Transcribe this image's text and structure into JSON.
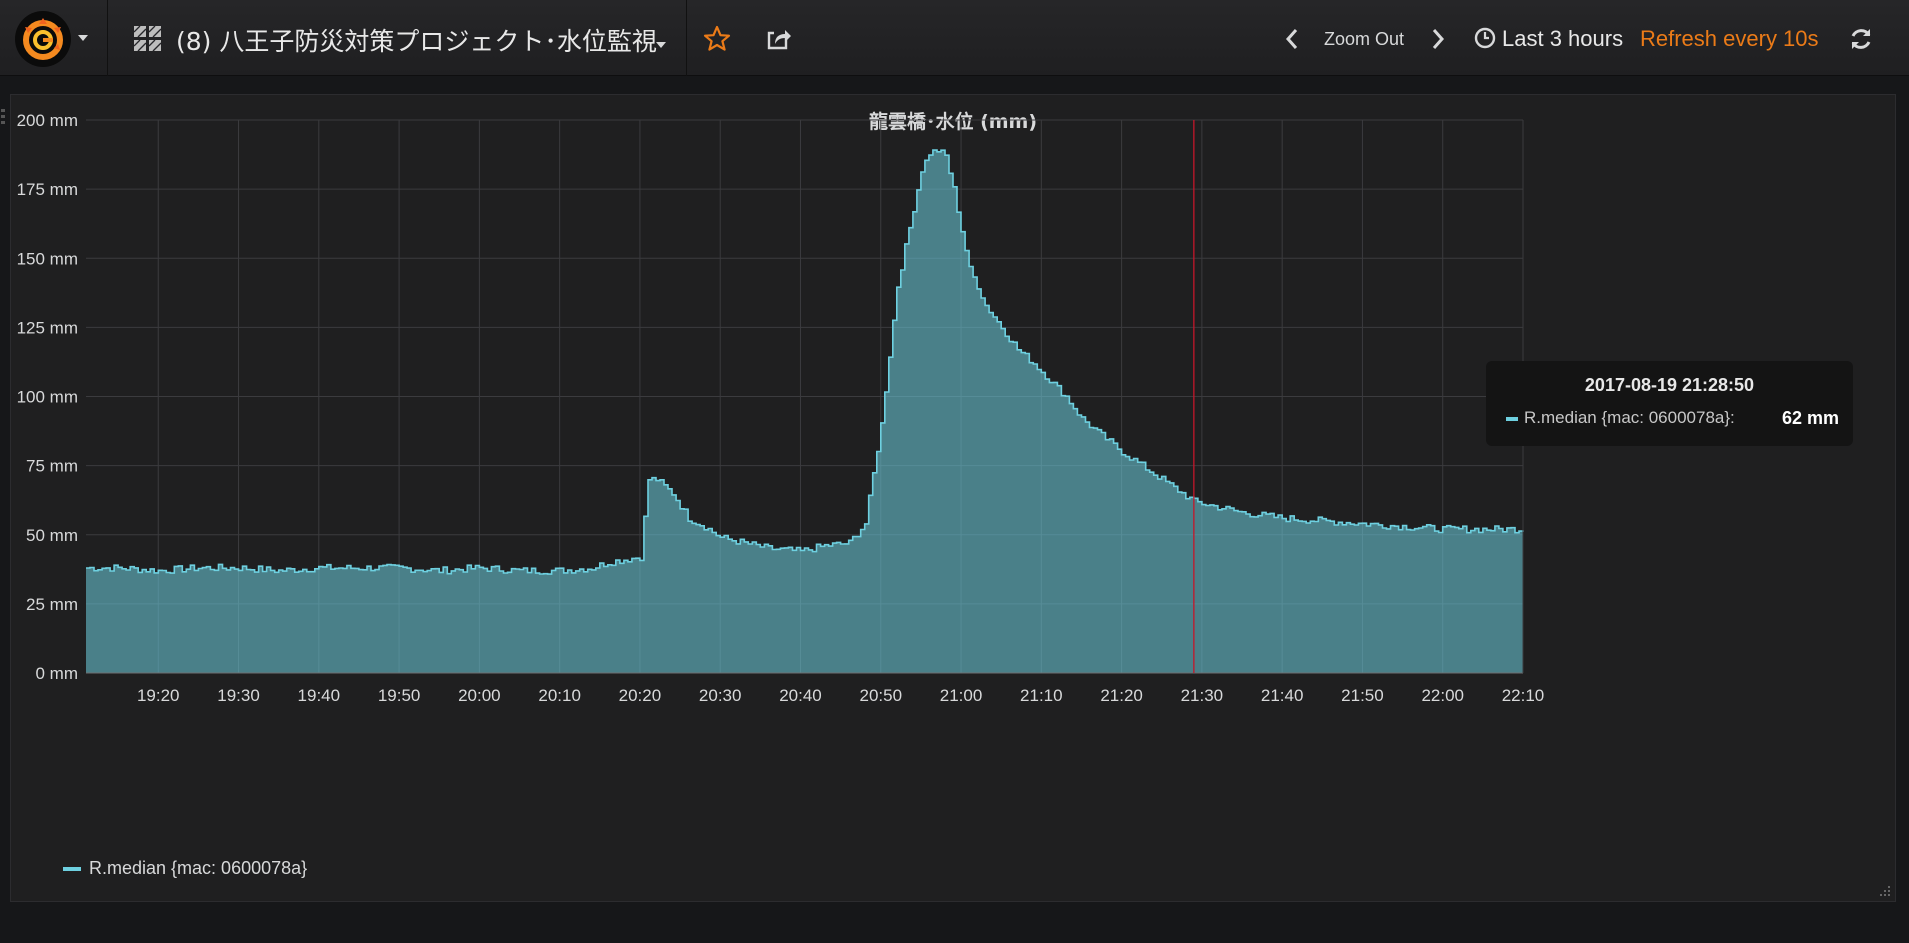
{
  "navbar": {
    "dashboard_title": "(8) 八王子防災対策プロジェクト･水位監視",
    "zoom_out_label": "Zoom Out",
    "time_range_label": "Last 3 hours",
    "refresh_label": "Refresh every 10s"
  },
  "icons": [
    "grafana-logo",
    "dashboard-grid-icon",
    "star-icon",
    "share-icon",
    "chevron-left-icon",
    "chevron-right-icon",
    "clock-icon",
    "refresh-icon"
  ],
  "colors": {
    "series": "#6ed0e0",
    "refresh_accent": "#eb7b18",
    "star": "#eb7b18",
    "cursor_line": "#c4162a"
  },
  "panel": {
    "title": "龍雲橋･水位 (mm)"
  },
  "tooltip": {
    "time": "2017-08-19 21:28:50",
    "series": "R.median {mac: 0600078a}:",
    "value": "62 mm"
  },
  "legend": {
    "label": "R.median {mac: 0600078a}"
  },
  "chart_data": {
    "type": "area",
    "title": "龍雲橋･水位 (mm)",
    "xlabel": "",
    "ylabel": "",
    "ylim": [
      0,
      200
    ],
    "x_range": [
      "19:11",
      "22:10"
    ],
    "y_ticks": [
      "0 mm",
      "25 mm",
      "50 mm",
      "75 mm",
      "100 mm",
      "125 mm",
      "150 mm",
      "175 mm",
      "200 mm"
    ],
    "y_tick_values": [
      0,
      25,
      50,
      75,
      100,
      125,
      150,
      175,
      200
    ],
    "x_ticks": [
      "19:20",
      "19:30",
      "19:40",
      "19:50",
      "20:00",
      "20:10",
      "20:20",
      "20:30",
      "20:40",
      "20:50",
      "21:00",
      "21:10",
      "21:20",
      "21:30",
      "21:40",
      "21:50",
      "22:00",
      "22:10"
    ],
    "grid": true,
    "legend_position": "bottom-left",
    "cursor_time": "21:29",
    "series": [
      {
        "name": "R.median {mac: 0600078a}",
        "x": [
          "19:11",
          "19:15",
          "19:20",
          "19:25",
          "19:30",
          "19:35",
          "19:40",
          "19:45",
          "19:50",
          "19:55",
          "20:00",
          "20:05",
          "20:10",
          "20:14",
          "20:16",
          "20:20",
          "20:21",
          "20:22",
          "20:24",
          "20:26",
          "20:28",
          "20:30",
          "20:33",
          "20:36",
          "20:40",
          "20:43",
          "20:46",
          "20:48",
          "20:50",
          "20:52",
          "20:54",
          "20:55",
          "20:56",
          "20:57",
          "20:58",
          "20:59",
          "21:00",
          "21:01",
          "21:02",
          "21:03",
          "21:05",
          "21:07",
          "21:09",
          "21:11",
          "21:13",
          "21:15",
          "21:17",
          "21:20",
          "21:23",
          "21:26",
          "21:29",
          "21:32",
          "21:35",
          "21:40",
          "21:45",
          "21:50",
          "21:55",
          "22:00",
          "22:05",
          "22:10"
        ],
        "values": [
          38,
          38,
          37,
          38,
          38,
          37,
          38,
          38,
          38,
          37,
          38,
          37,
          37,
          38,
          40,
          42,
          70,
          70,
          65,
          56,
          53,
          49,
          47,
          45,
          44,
          46,
          47,
          54,
          90,
          140,
          168,
          182,
          188,
          189,
          187,
          175,
          160,
          146,
          140,
          133,
          125,
          117,
          112,
          106,
          100,
          92,
          87,
          80,
          74,
          68,
          62,
          60,
          58,
          56,
          55,
          54,
          53,
          52,
          52,
          52
        ]
      }
    ]
  }
}
